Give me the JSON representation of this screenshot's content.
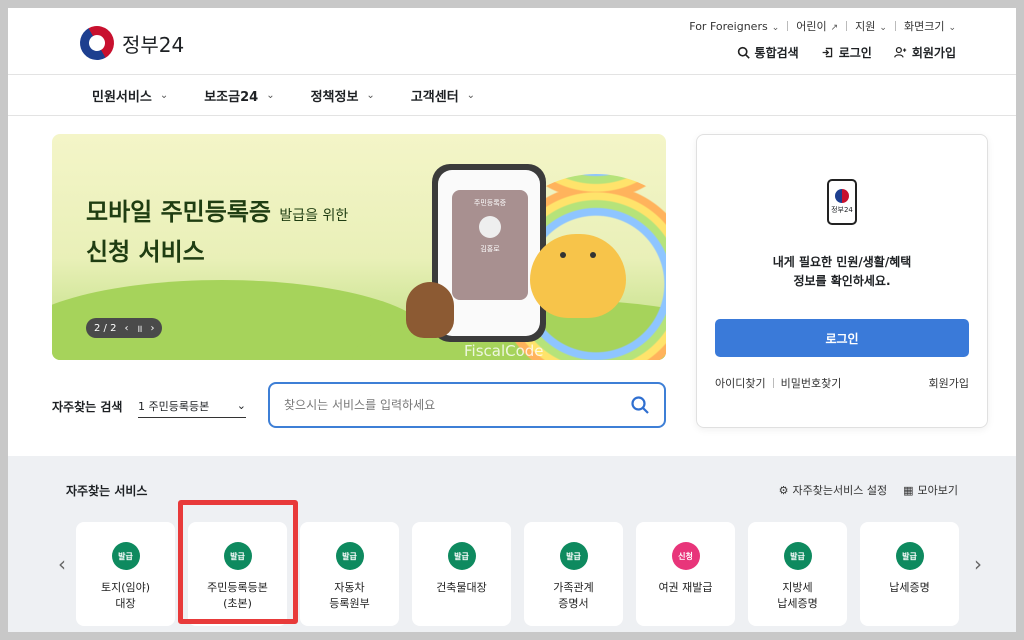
{
  "header": {
    "logo_text": "정부24",
    "utility": [
      {
        "label": "For Foreigners"
      },
      {
        "label": "어린이"
      },
      {
        "label": "지원"
      },
      {
        "label": "화면크기"
      }
    ],
    "actions": {
      "search": "통합검색",
      "login": "로그인",
      "signup": "회원가입"
    }
  },
  "nav": {
    "items": [
      {
        "label": "민원서비스"
      },
      {
        "label": "보조금24"
      },
      {
        "label": "정책정보"
      },
      {
        "label": "고객센터"
      }
    ]
  },
  "banner": {
    "title_line1": "모바일 주민등록증",
    "title_small": "발급을 위한",
    "title_line2": "신청 서비스",
    "card_title": "주민등록증",
    "card_name": "김홍로",
    "pager": "2 / 2",
    "watermark": "FiscalCode"
  },
  "search": {
    "label": "자주찾는 검색",
    "selected": "1 주민등록등본",
    "placeholder": "찾으시는 서비스를 입력하세요"
  },
  "login_panel": {
    "icon_text": "정부24",
    "message_line1": "내게 필요한 민원/생활/혜택",
    "message_line2": "정보를 확인하세요.",
    "button": "로그인",
    "find_id": "아이디찾기",
    "find_pw": "비밀번호찾기",
    "join": "회원가입"
  },
  "services": {
    "title": "자주찾는 서비스",
    "settings": "자주찾는서비스 설정",
    "view_all": "모아보기",
    "items": [
      {
        "badge": "발급",
        "label": "토지(임야)\n대장",
        "badge_color": "#0e8a5f"
      },
      {
        "badge": "발급",
        "label": "주민등록등본\n(초본)",
        "badge_color": "#0e8a5f"
      },
      {
        "badge": "발급",
        "label": "자동차\n등록원부",
        "badge_color": "#0e8a5f"
      },
      {
        "badge": "발급",
        "label": "건축물대장",
        "badge_color": "#0e8a5f"
      },
      {
        "badge": "발급",
        "label": "가족관계\n증명서",
        "badge_color": "#0e8a5f"
      },
      {
        "badge": "신청",
        "label": "여권 재발급",
        "badge_color": "#e8357a"
      },
      {
        "badge": "발급",
        "label": "지방세\n납세증명",
        "badge_color": "#0e8a5f"
      },
      {
        "badge": "발급",
        "label": "납세증명",
        "badge_color": "#0e8a5f"
      }
    ]
  },
  "colors": {
    "accent": "#3a7ad9",
    "highlight": "#e83a3a"
  }
}
